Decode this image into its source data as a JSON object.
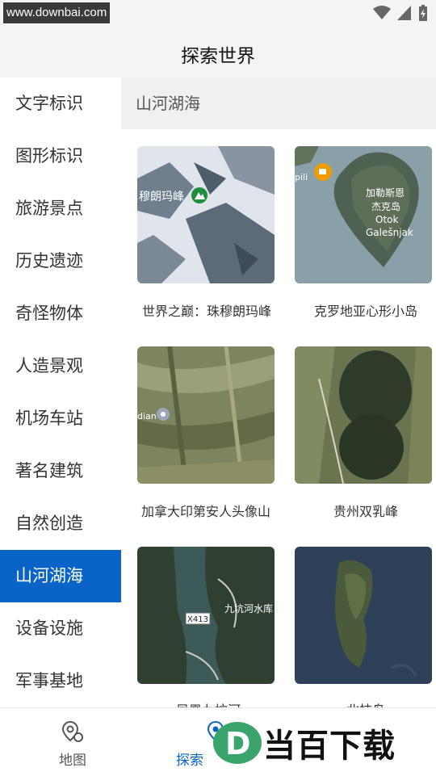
{
  "status": {
    "watermark": "www.downbai.com"
  },
  "header": {
    "title": "探索世界"
  },
  "sidebar": {
    "items": [
      {
        "label": "文字标识"
      },
      {
        "label": "图形标识"
      },
      {
        "label": "旅游景点"
      },
      {
        "label": "历史遗迹"
      },
      {
        "label": "奇怪物体"
      },
      {
        "label": "人造景观"
      },
      {
        "label": "机场车站"
      },
      {
        "label": "著名建筑"
      },
      {
        "label": "自然创造"
      },
      {
        "label": "山河湖海"
      },
      {
        "label": "设备设施"
      },
      {
        "label": "军事基地"
      }
    ],
    "active": "山河湖海"
  },
  "main": {
    "section_title": "山河湖海",
    "cards": [
      {
        "caption": "世界之巅：珠穆朗玛峰",
        "map_label": "穆朗玛峰"
      },
      {
        "caption": "克罗地亚心形小岛",
        "map_label_1": "加勒斯恩",
        "map_label_2": "杰克岛",
        "map_label_3": "Otok",
        "map_label_4": "Galešnjak",
        "map_label_5": "pili"
      },
      {
        "caption": "加拿大印第安人头像山",
        "map_label": "dian"
      },
      {
        "caption": "贵州双乳峰"
      },
      {
        "caption": "凤凰九坑河",
        "map_label_1": "X413",
        "map_label_2": "九坑河水库"
      },
      {
        "caption": "北枝岛"
      }
    ]
  },
  "tabs": [
    {
      "label": "地图",
      "icon": "map-pin-icon"
    },
    {
      "label": "探索",
      "icon": "explore-icon"
    }
  ],
  "brand": {
    "text": "当百下载",
    "icon_letter": "D"
  },
  "colors": {
    "accent": "#0a64c8"
  }
}
